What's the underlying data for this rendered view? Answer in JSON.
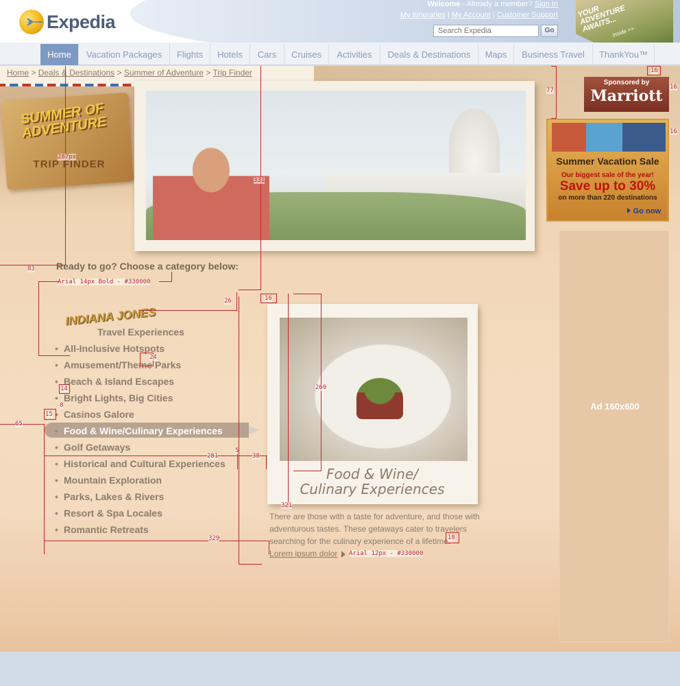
{
  "header": {
    "logo_text": "Expedia",
    "welcome_bold": "Welcome",
    "welcome_rest": " - Already a member? ",
    "sign_in": "Sign In",
    "links": [
      "My Itineraries",
      "My Account",
      "Customer Support"
    ],
    "search_placeholder": "Search Expedia",
    "go_label": "Go",
    "promo_text": "YOUR ADVENTURE AWAITS...",
    "promo_inside": "inside >>"
  },
  "nav": {
    "tabs": [
      "Home",
      "Vacation Packages",
      "Flights",
      "Hotels",
      "Cars",
      "Cruises",
      "Activities",
      "Deals & Destinations",
      "Maps",
      "Business Travel",
      "ThankYou™"
    ],
    "active_index": 0
  },
  "breadcrumb": {
    "items": [
      "Home",
      "Deals & Destinations",
      "Summer of Adventure",
      "Trip Finder"
    ],
    "separator": ">"
  },
  "badge": {
    "title": "SUMMER OF ADVENTURE",
    "subtitle": "TRIP FINDER"
  },
  "main": {
    "prompt": "Ready to go? Choose a category below:",
    "featured_logo": "INDIANA JONES",
    "featured_sub": "Travel Experiences",
    "categories": [
      "All-Inclusive Hotspots",
      "Amusement/Theme Parks",
      "Beach & Island Escapes",
      "Bright Lights, Big Cities",
      "Casinos Galore",
      "Food & Wine/Culinary Experiences",
      "Golf Getaways",
      "Historical and Cultural Experiences",
      "Mountain Exploration",
      "Parks, Lakes & Rivers",
      "Resort & Spa Locales",
      "Romantic Retreats"
    ],
    "selected_index": 5,
    "detail": {
      "caption_line1": "Food & Wine/",
      "caption_line2": "Culinary Experiences",
      "description": "There are those with a taste for adventure, and those with adventurous tastes. These getaways cater to travelers searching for the culinary experience of a lifetime.",
      "link": "Lorem ipsum dolor"
    }
  },
  "ads": {
    "marriott_sponsor": "Sponsored by",
    "marriott_brand": "Marriott",
    "sale_title": "Summer Vacation Sale",
    "sale_sub": "Our biggest sale of the year!",
    "sale_big": "Save up to 30%",
    "sale_more": "on more than 220 destinations",
    "sale_go": "Go now",
    "slot_label": "Ad 160x600"
  },
  "annotations": {
    "a287": "287px",
    "a331": "331",
    "a83": "83",
    "prompt_spec": "Arial 14px Bold - #330000",
    "a26": "26",
    "a16a": "16",
    "a24": "24",
    "a14": "14",
    "a8": "8",
    "a15": "15",
    "a65": "65",
    "a260": "260",
    "a281": "281",
    "a5": "5",
    "a38": "38",
    "a321": "321",
    "a18": "18",
    "a329": "329",
    "link_spec": "Arial 12px - #330000",
    "a77": "77",
    "a16b": "16",
    "a16c": "16",
    "a16d": "16"
  },
  "colors": {
    "accent": "#7e9ac3",
    "annotation": "#c0262c",
    "text_brown": "#8c7c6c",
    "sale_red": "#c0120c"
  }
}
